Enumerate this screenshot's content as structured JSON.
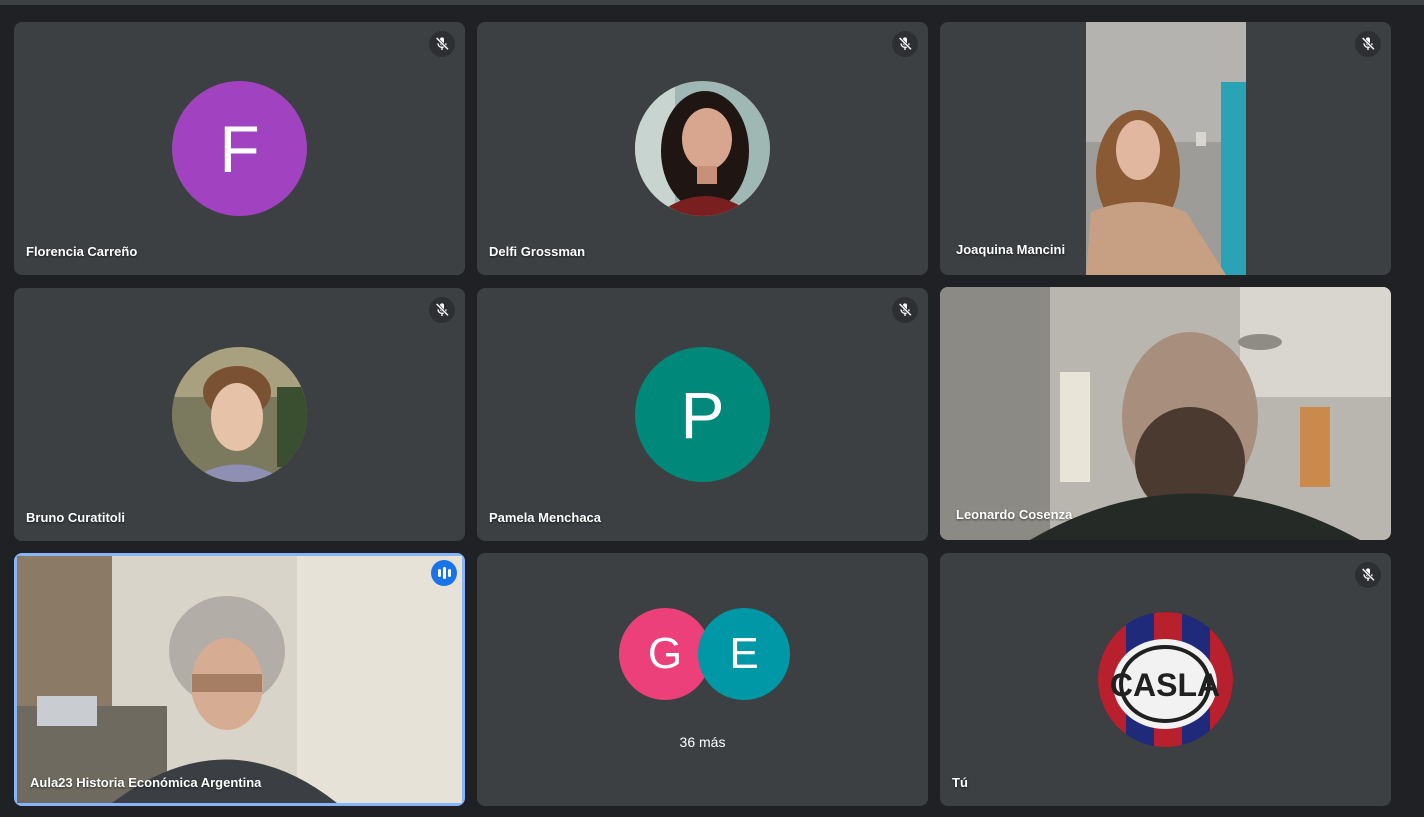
{
  "colors": {
    "tile_bg": "#3c4043",
    "page_bg": "#202124",
    "speaking_outline": "#8ab4f8",
    "speaking_badge": "#1a73e8",
    "avatar_florencia": "#a142c0",
    "avatar_pamela": "#00897b",
    "avatar_g": "#ec407a",
    "avatar_e": "#0097a7"
  },
  "participants": [
    {
      "name": "Florencia Carreño",
      "initial": "F",
      "muted": true,
      "view": "initial-avatar"
    },
    {
      "name": "Delfi Grossman",
      "muted": true,
      "view": "photo-avatar"
    },
    {
      "name": "Joaquina Mancini",
      "muted": true,
      "view": "camera"
    },
    {
      "name": "Bruno Curatitoli",
      "muted": true,
      "view": "photo-avatar"
    },
    {
      "name": "Pamela Menchaca",
      "initial": "P",
      "muted": true,
      "view": "initial-avatar"
    },
    {
      "name": "Leonardo Cosenza",
      "muted": false,
      "view": "camera"
    },
    {
      "name": "Aula23 Historia Económica Argentina",
      "muted": false,
      "speaking": true,
      "view": "camera"
    },
    {
      "name": "Tú",
      "muted": true,
      "view": "photo-avatar"
    }
  ],
  "more": {
    "initials": [
      "G",
      "E"
    ],
    "label": "36 más"
  },
  "icons": {
    "mute": "mic-off-icon",
    "speaking": "audio-level-icon"
  }
}
